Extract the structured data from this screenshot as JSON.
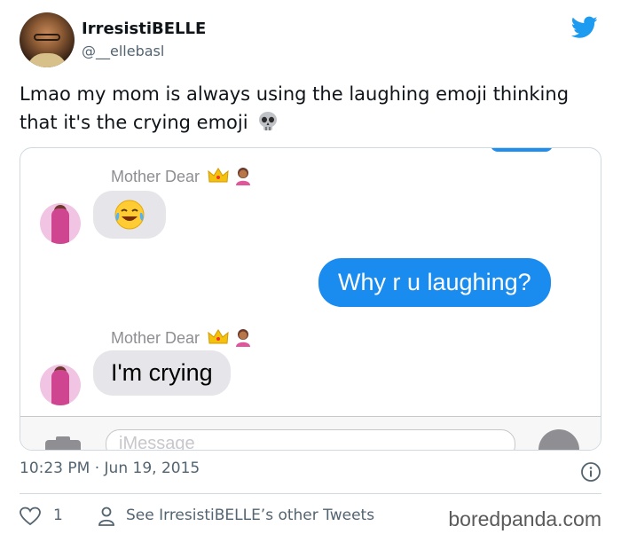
{
  "author": {
    "display_name": "IrresistiBELLE",
    "handle": "@__ellebasl"
  },
  "tweet": {
    "text": "Lmao my mom is always using the laughing emoji thinking that it's the crying emoji",
    "emoji": "skull"
  },
  "conversation": {
    "sender_name": "Mother Dear",
    "messages": [
      {
        "from": "Mother Dear",
        "type": "emoji",
        "emoji": "face-with-tears-of-joy"
      },
      {
        "from": "me",
        "type": "text",
        "text": "Why r u laughing?"
      },
      {
        "from": "Mother Dear",
        "type": "text",
        "text": "I'm crying"
      }
    ],
    "input_placeholder": "iMessage"
  },
  "meta": {
    "time": "10:23 PM",
    "separator": "·",
    "date": "Jun 19, 2015"
  },
  "footer": {
    "like_count": "1",
    "see_other": "See IrresistiBELLE’s other Tweets"
  },
  "watermark": "boredpanda.com",
  "colors": {
    "imessage_blue": "#1a8cf0",
    "gray_bubble": "#e5e5ea",
    "twitter_blue": "#1d9bf0",
    "secondary_text": "#536471"
  }
}
